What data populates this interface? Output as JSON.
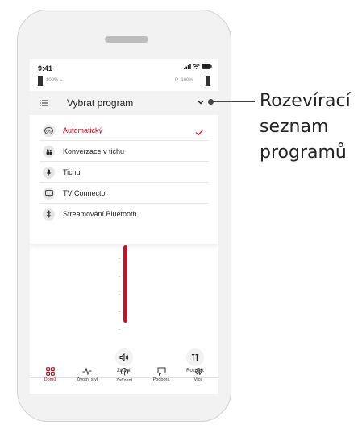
{
  "status_bar": {
    "time": "9:41"
  },
  "hearing_aids": {
    "left": {
      "battery_text": "100%",
      "side": "L"
    },
    "right": {
      "side": "P",
      "battery_text": "100%"
    }
  },
  "dropdown": {
    "title": "Vybrat program",
    "programs": [
      {
        "label": "Automatický",
        "icon": "automatic-os-icon",
        "selected": true
      },
      {
        "label": "Konverzace v tichu",
        "icon": "people-icon",
        "selected": false
      },
      {
        "label": "Tichu",
        "icon": "microphone-icon",
        "selected": false
      },
      {
        "label": "TV Connector",
        "icon": "tv-icon",
        "selected": false
      },
      {
        "label": "Streamování Bluetooth",
        "icon": "bluetooth-icon",
        "selected": false
      }
    ]
  },
  "volume": {
    "level_fraction": 1.0
  },
  "actions": {
    "mute_label": "Ztlumit",
    "split_label": "Rozdělit"
  },
  "tab_bar": {
    "tabs": [
      {
        "label": "Domů",
        "icon": "home-grid-icon",
        "active": true
      },
      {
        "label": "Životní styl",
        "icon": "activity-icon",
        "active": false
      },
      {
        "label": "Zařízení",
        "icon": "hearing-aid-icon",
        "active": false
      },
      {
        "label": "Podpora",
        "icon": "chat-icon",
        "active": false
      },
      {
        "label": "Více",
        "icon": "gear-icon",
        "active": false
      }
    ]
  },
  "callout": {
    "line1": "Rozevírací",
    "line2": "seznam",
    "line3": "programů"
  },
  "colors": {
    "accent": "#d0021b",
    "volume_bar": "#c8102e"
  }
}
